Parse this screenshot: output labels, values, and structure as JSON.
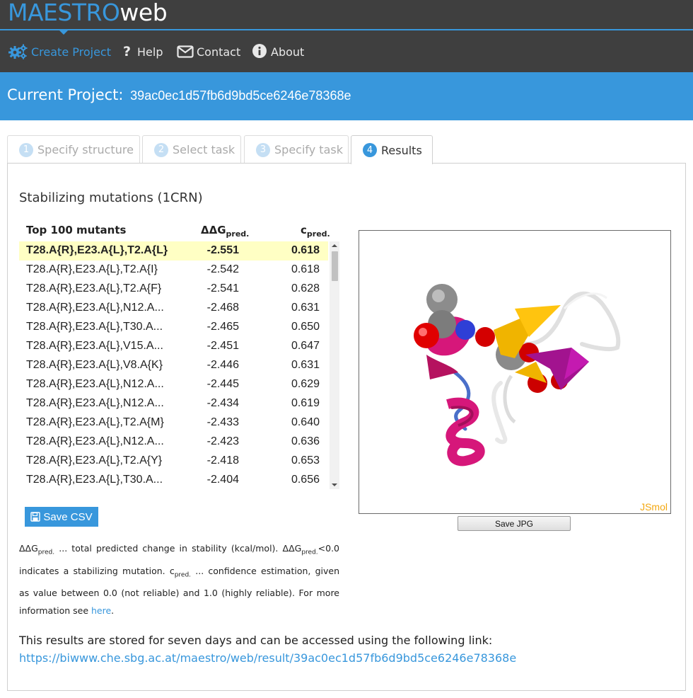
{
  "brand": {
    "part1": "MAESTRO",
    "part2": "web"
  },
  "nav": [
    {
      "label": "Create Project",
      "icon": "gears-icon",
      "active": true
    },
    {
      "label": "Help",
      "icon": "question-icon"
    },
    {
      "label": "Contact",
      "icon": "envelope-icon"
    },
    {
      "label": "About",
      "icon": "info-icon"
    }
  ],
  "banner": {
    "label": "Current Project:",
    "project_id": "39ac0ec1d57fb6d9bd5ce6246e78368e"
  },
  "tabs": [
    {
      "num": "1",
      "label": "Specify structure"
    },
    {
      "num": "2",
      "label": "Select task"
    },
    {
      "num": "3",
      "label": "Specify task"
    },
    {
      "num": "4",
      "label": "Results"
    }
  ],
  "results": {
    "title": "Stabilizing mutations (1CRN)",
    "col_mutant": "Top 100 mutants",
    "col_ddg": "ΔΔG",
    "col_ddg_sub": "pred.",
    "col_c": "c",
    "col_c_sub": "pred.",
    "rows": [
      {
        "mutant": "T28.A{R},E23.A{L},T2.A{L}",
        "ddg": "-2.551",
        "c": "0.618"
      },
      {
        "mutant": "T28.A{R},E23.A{L},T2.A{I}",
        "ddg": "-2.542",
        "c": "0.618"
      },
      {
        "mutant": "T28.A{R},E23.A{L},T2.A{F}",
        "ddg": "-2.541",
        "c": "0.628"
      },
      {
        "mutant": "T28.A{R},E23.A{L},N12.A...",
        "ddg": "-2.468",
        "c": "0.631"
      },
      {
        "mutant": "T28.A{R},E23.A{L},T30.A...",
        "ddg": "-2.465",
        "c": "0.650"
      },
      {
        "mutant": "T28.A{R},E23.A{L},V15.A...",
        "ddg": "-2.451",
        "c": "0.647"
      },
      {
        "mutant": "T28.A{R},E23.A{L},V8.A{K}",
        "ddg": "-2.446",
        "c": "0.631"
      },
      {
        "mutant": "T28.A{R},E23.A{L},N12.A...",
        "ddg": "-2.445",
        "c": "0.629"
      },
      {
        "mutant": "T28.A{R},E23.A{L},N12.A...",
        "ddg": "-2.434",
        "c": "0.619"
      },
      {
        "mutant": "T28.A{R},E23.A{L},T2.A{M}",
        "ddg": "-2.433",
        "c": "0.640"
      },
      {
        "mutant": "T28.A{R},E23.A{L},N12.A...",
        "ddg": "-2.423",
        "c": "0.636"
      },
      {
        "mutant": "T28.A{R},E23.A{L},T2.A{Y}",
        "ddg": "-2.418",
        "c": "0.653"
      },
      {
        "mutant": "T28.A{R},E23.A{L},T30.A...",
        "ddg": "-2.404",
        "c": "0.656"
      }
    ],
    "save_csv": "Save CSV",
    "save_jpg": "Save JPG",
    "viewer_label": "JSmol"
  },
  "legend": {
    "p1": "ΔΔG",
    "p1_sub": "pred.",
    "p2": " ... total predicted change in stability (kcal/mol). ΔΔG",
    "p2_sub": "pred.",
    "p3": "<0.0 indicates a stabilizing mutation. c",
    "p3_sub": "pred.",
    "p4": " ... confidence estimation, given as value between 0.0 (not reliable) and 1.0 (highly reliable). For more information see ",
    "link": "here",
    "p5": "."
  },
  "note": {
    "text": "This results are stored for seven days and can be accessed using the following link:",
    "link": "https://biwww.che.sbg.ac.at/maestro/web/result/39ac0ec1d57fb6d9bd5ce6246e78368e"
  },
  "colors": {
    "accent": "#3897dc",
    "topbar": "#3f3f3f",
    "highlight": "#ffffc4",
    "jsmol": "#f3a812"
  }
}
